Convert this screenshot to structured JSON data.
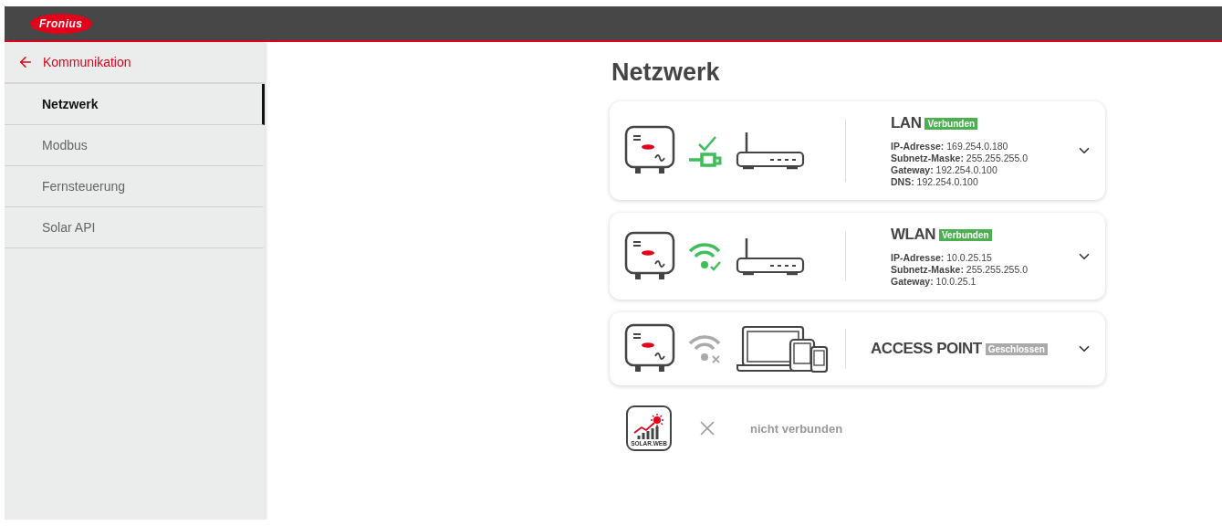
{
  "header": {
    "logo": "Fronius"
  },
  "sidebar": {
    "back": "Kommunikation",
    "items": [
      {
        "label": "Netzwerk",
        "selected": true
      },
      {
        "label": "Modbus",
        "selected": false
      },
      {
        "label": "Fernsteuerung",
        "selected": false
      },
      {
        "label": "Solar API",
        "selected": false
      }
    ]
  },
  "page_title": "Netzwerk",
  "connections": [
    {
      "kind": "lan",
      "name": "LAN",
      "status": "Verbunden",
      "connected": true,
      "details": [
        {
          "label": "IP-Adresse:",
          "value": "169.254.0.180"
        },
        {
          "label": "Subnetz-Maske:",
          "value": "255.255.255.0"
        },
        {
          "label": "Gateway:",
          "value": "192.254.0.100"
        },
        {
          "label": "DNS:",
          "value": "192.254.0.100"
        }
      ]
    },
    {
      "kind": "wlan",
      "name": "WLAN",
      "status": "Verbunden",
      "connected": true,
      "details": [
        {
          "label": "IP-Adresse:",
          "value": "10.0.25.15"
        },
        {
          "label": "Subnetz-Maske:",
          "value": "255.255.255.0"
        },
        {
          "label": "Gateway:",
          "value": "10.0.25.1"
        }
      ]
    },
    {
      "kind": "access_point",
      "name": "ACCESS POINT",
      "status": "Geschlossen",
      "connected": false
    }
  ],
  "solar_web": {
    "label": "SOLAR.WEB",
    "status": "nicht verbunden",
    "connected": false
  }
}
